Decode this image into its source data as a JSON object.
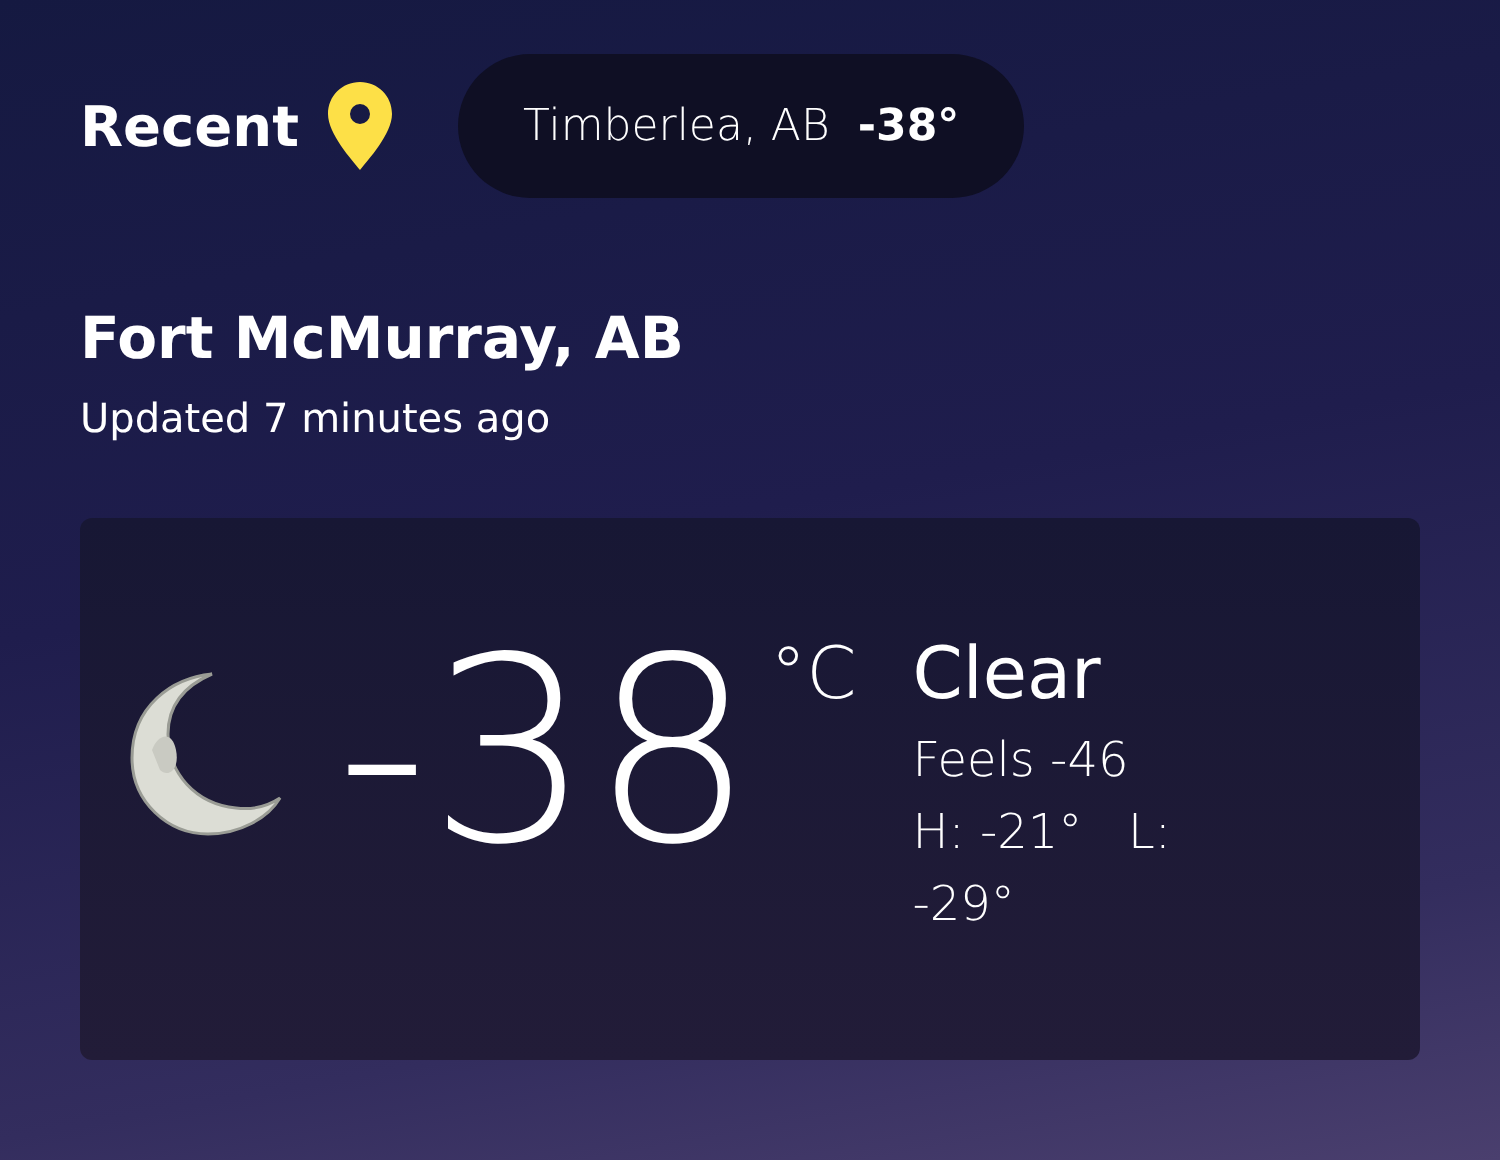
{
  "recent": {
    "label": "Recent",
    "locations": [
      {
        "name": "Timberlea, AB",
        "temp": "-38°"
      }
    ]
  },
  "location": {
    "name": "Fort McMurray, AB",
    "updated": "Updated 7 minutes ago"
  },
  "current": {
    "kind": "moon",
    "temperature": "-38",
    "unit": "°C",
    "condition": "Clear",
    "feels": "Feels -46",
    "high_low": "H: -21°   L: -29°"
  }
}
